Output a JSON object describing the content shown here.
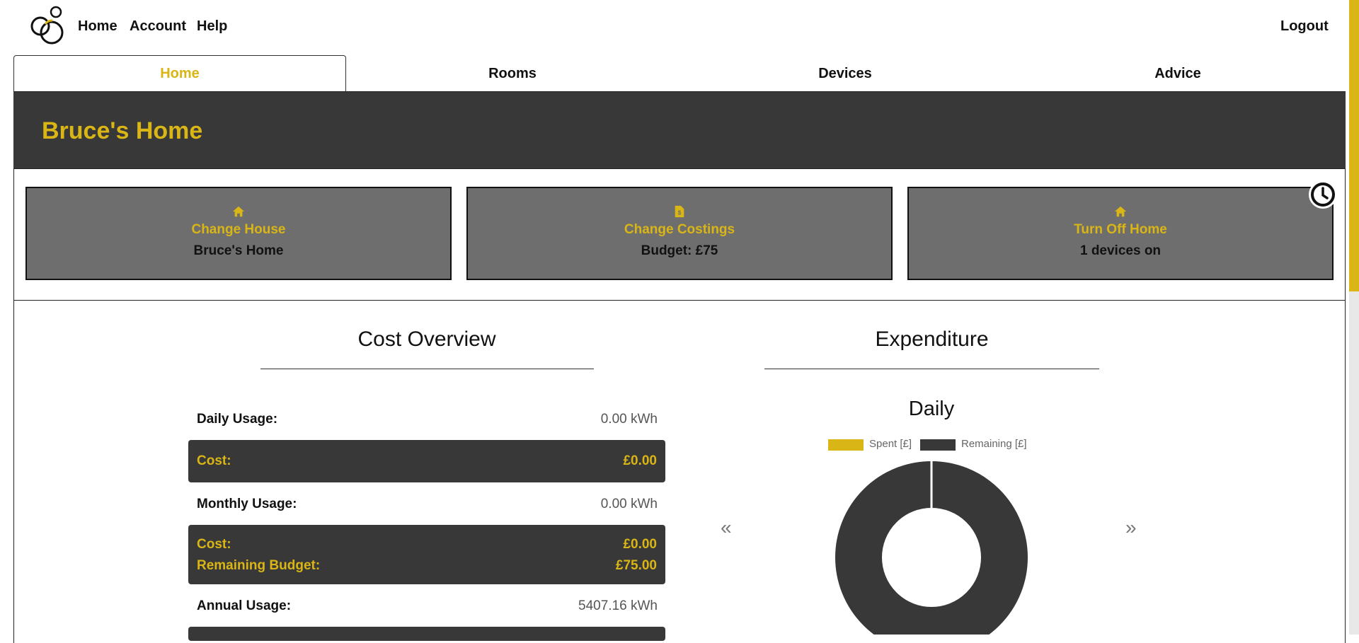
{
  "nav": {
    "links": [
      {
        "label": "Home"
      },
      {
        "label": "Account"
      },
      {
        "label": "Help"
      }
    ],
    "logout": "Logout"
  },
  "tabs": [
    {
      "label": "Home",
      "active": true
    },
    {
      "label": "Rooms"
    },
    {
      "label": "Devices"
    },
    {
      "label": "Advice"
    }
  ],
  "header": {
    "title": "Bruce's Home"
  },
  "cards": [
    {
      "icon": "home-icon",
      "title": "Change House",
      "subtitle": "Bruce's Home"
    },
    {
      "icon": "file-invoice-icon",
      "title": "Change Costings",
      "subtitle": "Budget: £75"
    },
    {
      "icon": "home-icon",
      "title": "Turn Off Home",
      "subtitle": "1 devices on"
    }
  ],
  "cost_overview": {
    "title": "Cost Overview",
    "daily_usage_label": "Daily Usage:",
    "daily_usage_value": "0.00 kWh",
    "daily_cost_label": "Cost:",
    "daily_cost_value": "£0.00",
    "monthly_usage_label": "Monthly Usage:",
    "monthly_usage_value": "0.00 kWh",
    "monthly_cost_label": "Cost:",
    "monthly_cost_value": "£0.00",
    "remaining_budget_label": "Remaining Budget:",
    "remaining_budget_value": "£75.00",
    "annual_usage_label": "Annual Usage:",
    "annual_usage_value": "5407.16 kWh"
  },
  "expenditure": {
    "title": "Expenditure",
    "prev": "«",
    "next": "»"
  },
  "chart_data": {
    "type": "pie",
    "title": "Daily",
    "categories": [
      "Spent [£]",
      "Remaining [£]"
    ],
    "values": [
      0,
      75
    ],
    "colors": [
      "#d9b515",
      "#383838"
    ],
    "donut": true,
    "legend_position": "top"
  },
  "colors": {
    "accent": "#d9b515",
    "dark": "#383838",
    "card": "#6e6e6e"
  }
}
